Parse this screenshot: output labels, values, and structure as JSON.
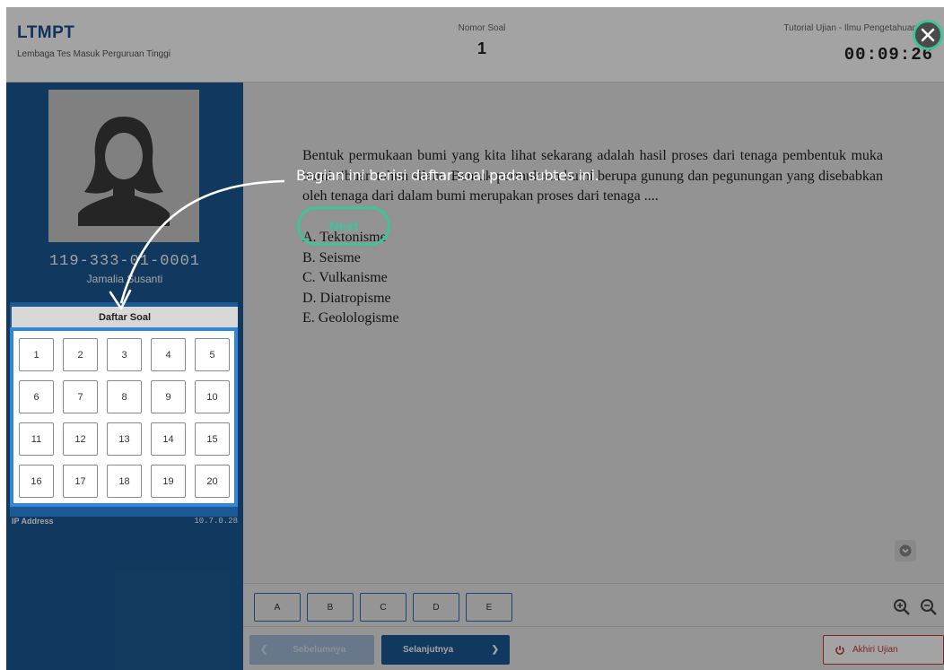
{
  "header": {
    "brand": "LTMPT",
    "brand_subtitle": "Lembaga Tes Masuk Perguruan Tinggi",
    "question_number_label": "Nomor Soal",
    "question_number": "1",
    "exam_name": "Tutorial Ujian - Ilmu Pengetahuan",
    "timer": "00:09:26"
  },
  "sidebar": {
    "student_id": "119-333-01-0001",
    "student_name": "Jamalia Susanti",
    "question_list_title": "Daftar Soal",
    "question_numbers": [
      "1",
      "2",
      "3",
      "4",
      "5",
      "6",
      "7",
      "8",
      "9",
      "10",
      "11",
      "12",
      "13",
      "14",
      "15",
      "16",
      "17",
      "18",
      "19",
      "20"
    ],
    "ip_label": "IP Address",
    "ip_value": "10.7.0.28"
  },
  "question": {
    "text": "Bentuk permukaan bumi yang kita lihat sekarang adalah hasil proses dari tenaga pembentuk muka bumi ribuan tahun silam. Bentuk permukaan bumi berupa gunung dan pegunungan yang disebabkan oleh tenaga dari dalam bumi merupakan proses dari tenaga ....",
    "options": [
      "A. Tektonisme",
      "B. Seisme",
      "C. Vulkanisme",
      "D. Diatropisme",
      "E. Geolologisme"
    ]
  },
  "answer_buttons": [
    "A",
    "B",
    "C",
    "D",
    "E"
  ],
  "navigation": {
    "prev_label": "Sebelumnya",
    "next_label": "Selanjutnya",
    "end_label": "Akhiri Ujian"
  },
  "tutorial": {
    "tip_text": "Bagian ini berisi daftar soal pada subtes ini.",
    "next_label": "Next"
  },
  "icons": {
    "close": "close-icon",
    "avatar": "user-avatar-icon",
    "scroll_down": "chevron-down-icon",
    "zoom_in": "zoom-in-icon",
    "zoom_out": "zoom-out-icon",
    "power": "power-icon"
  },
  "colors": {
    "brand_blue": "#1c5a95",
    "highlight_blue": "#2f86dd",
    "tutorial_green": "#3cc49a",
    "danger_red": "#c73a3a"
  }
}
